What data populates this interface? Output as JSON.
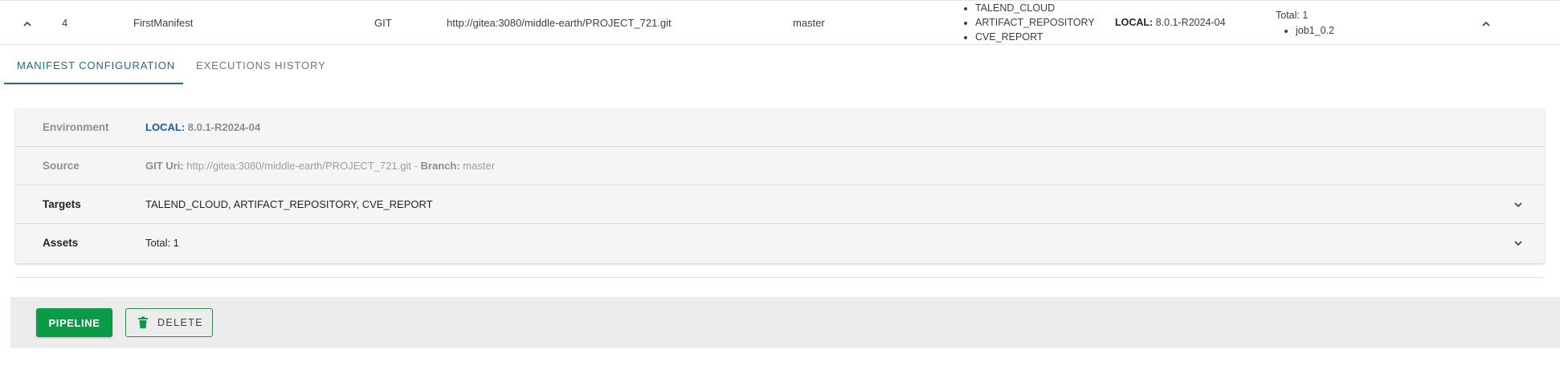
{
  "row": {
    "id": "4",
    "name": "FirstManifest",
    "source_type": "GIT",
    "url": "http://gitea:3080/middle-earth/PROJECT_721.git",
    "branch": "master",
    "targets": [
      "TALEND_CLOUD",
      "ARTIFACT_REPOSITORY",
      "CVE_REPORT"
    ],
    "env_label": "LOCAL:",
    "env_version": "8.0.1-R2024-04",
    "assets_total": "Total: 1",
    "assets": [
      "job1_0.2"
    ]
  },
  "tabs": [
    {
      "label": "MANIFEST CONFIGURATION",
      "active": true
    },
    {
      "label": "EXECUTIONS HISTORY",
      "active": false
    }
  ],
  "card": {
    "environment": {
      "label": "Environment",
      "env_name": "LOCAL:",
      "version": "8.0.1-R2024-04"
    },
    "source": {
      "label": "Source",
      "uri_label": "GIT Uri:",
      "uri": "http://gitea:3080/middle-earth/PROJECT_721.git",
      "sep": "-",
      "branch_label": "Branch:",
      "branch": "master"
    },
    "targets": {
      "label": "Targets",
      "value": "TALEND_CLOUD, ARTIFACT_REPOSITORY, CVE_REPORT"
    },
    "assets": {
      "label": "Assets",
      "value": "Total: 1"
    }
  },
  "footer": {
    "pipeline_label": "PIPELINE",
    "delete_label": "DELETE"
  },
  "colors": {
    "accent": "#1e6b86",
    "primary_button": "#0b9a45",
    "env_blue": "#1e5aa8"
  },
  "icons": {
    "row_collapse": "chevron-up-icon",
    "row_expand_right": "chevron-up-icon",
    "expand": "chevron-down-icon",
    "delete": "trash-icon"
  }
}
